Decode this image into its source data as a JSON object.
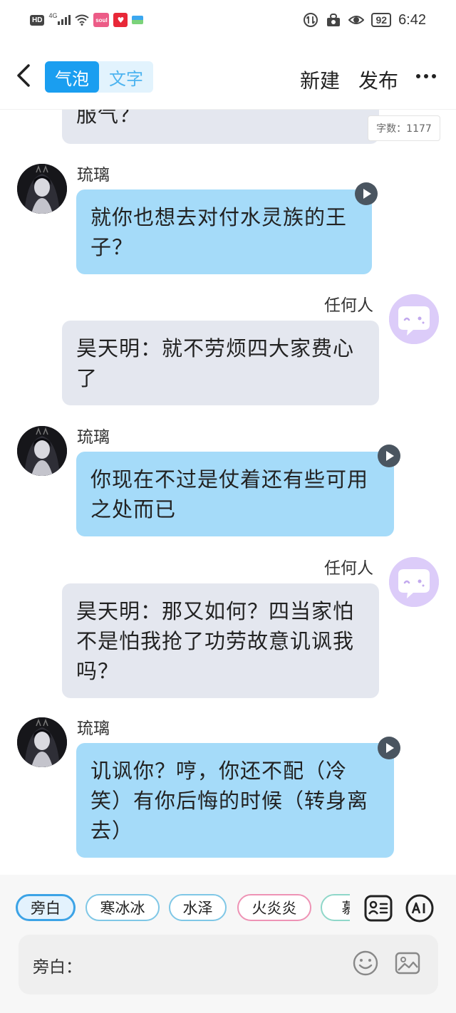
{
  "status_bar": {
    "hd": "HD",
    "network": "4G",
    "battery": "92",
    "time": "6:42",
    "app_badge": "soul"
  },
  "nav": {
    "tabs": [
      {
        "label": "气泡",
        "active": true
      },
      {
        "label": "文字",
        "active": false
      }
    ],
    "new_label": "新建",
    "publish_label": "发布"
  },
  "word_count": "字数：1177",
  "messages": [
    {
      "id": "m0",
      "side": "right",
      "speaker": "",
      "lines": [
        "服气？"
      ]
    },
    {
      "id": "m1",
      "side": "left",
      "speaker": "琉璃",
      "lines": [
        "就你也想去对付水灵族的王",
        "子？"
      ]
    },
    {
      "id": "m2",
      "side": "right",
      "speaker": "任何人",
      "lines": [
        "昊天明：就不劳烦四大家费心",
        "了"
      ]
    },
    {
      "id": "m3",
      "side": "left",
      "speaker": "琉璃",
      "lines": [
        "你现在不过是仗着还有些可用",
        "之处而已"
      ]
    },
    {
      "id": "m4",
      "side": "right",
      "speaker": "任何人",
      "lines": [
        "昊天明：那又如何？四当家怕",
        "不是怕我抢了功劳故意讥讽我",
        "吗？"
      ]
    },
    {
      "id": "m5",
      "side": "left",
      "speaker": "琉璃",
      "lines": [
        "讥讽你？哼，你还不配（冷",
        "笑）有你后悔的时候（转身离",
        "去）"
      ]
    }
  ],
  "chips": [
    "旁白",
    "寒冰冰",
    "水泽",
    "火炎炎",
    "慕"
  ],
  "composer": {
    "label": "旁白：",
    "value": ""
  },
  "colors": {
    "accent": "#1a9ef0",
    "bubble_self": "#e4e7ef",
    "bubble_other": "#a5dbf9",
    "avatar_self": "#dcccf9"
  }
}
